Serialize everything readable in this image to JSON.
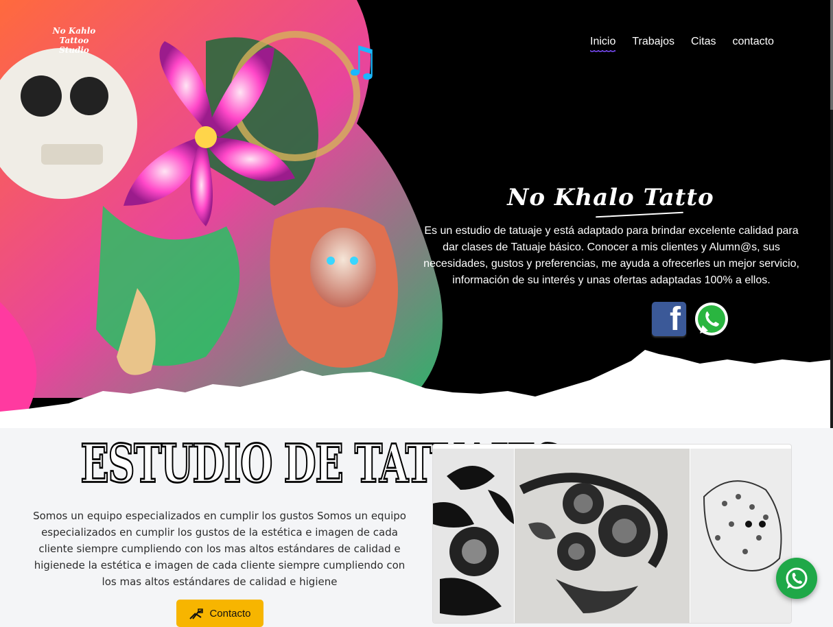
{
  "logo": {
    "lines": [
      "No Kahlo",
      "Tattoo",
      "Studio"
    ]
  },
  "nav": {
    "items": [
      {
        "label": "Inicio",
        "active": true
      },
      {
        "label": "Trabajos",
        "active": false
      },
      {
        "label": "Citas",
        "active": false
      },
      {
        "label": "contacto",
        "active": false
      }
    ]
  },
  "hero": {
    "brand": "No Khalo Tatto",
    "description": "Es un estudio de tatuaje y está adaptado para brindar excelente calidad para dar clases de Tatuaje básico. Conocer a mis clientes y Alumn@s, sus necesidades, gustos y preferencias, me ayuda a ofrecerles un mejor servicio, información de su interés y unas ofertas adaptadas 100% a ellos.",
    "social": {
      "facebook_icon": "facebook-icon",
      "facebook_letter": "f",
      "whatsapp_icon": "whatsapp-icon"
    }
  },
  "studio": {
    "title": "ESTUDIO DE TATUAJES",
    "text": "Somos un equipo especializados en cumplir los gustos Somos un equipo especializados en cumplir los gustos de la estética e imagen de cada cliente siempre cumpliendo con los mas altos estándares de calidad e higienede la estética e imagen de cada cliente siempre cumpliendo con los mas altos estándares de calidad e higiene",
    "button_label": "Contacto",
    "button_icon": "tattoo-machine-icon"
  },
  "colors": {
    "accent": "#7c4dff",
    "button": "#f7b500",
    "whatsapp": "#1fa848",
    "facebook": "#3b5998"
  }
}
